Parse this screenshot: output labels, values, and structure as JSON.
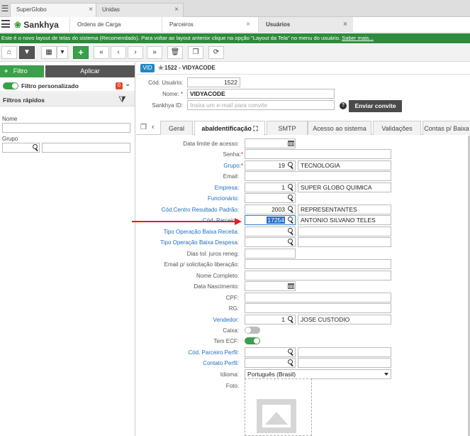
{
  "browser_tabs": [
    {
      "label": "SuperGlobo",
      "active": true
    },
    {
      "label": "Unidas",
      "active": false
    }
  ],
  "app": {
    "logo_text": "Sankhya",
    "tabs": [
      {
        "label": "Ordens de Carga"
      },
      {
        "label": "Parceiros"
      },
      {
        "label": "Usuários"
      }
    ]
  },
  "notice": {
    "text": "Este é o novo layout de telas do sistema (Recomendado). Para voltar ao layout anterior clique na opção \"Layout da Tela\" no menu do usuário.",
    "link": "Saber mais..."
  },
  "toolbar": {
    "icons": [
      "home-icon",
      "filter-icon",
      "grid-icon",
      "dropdown-icon",
      "add-icon",
      "first-icon",
      "prev-icon",
      "next-icon",
      "last-icon",
      "delete-icon",
      "copy-icon",
      "refresh-icon"
    ],
    "glyphs": [
      "⌂",
      "▼",
      "▦",
      "▾",
      "+",
      "«",
      "‹",
      "›",
      "»",
      "🗑",
      "❐",
      "⟳"
    ]
  },
  "left_panel": {
    "filter_button": "Filtro",
    "apply_button": "Aplicar",
    "custom_filter_label": "Filtro personalizado",
    "custom_filter_count": "0",
    "quick_filters_title": "Filtros rápidos",
    "fields": [
      {
        "label": "Nome"
      },
      {
        "label": "Grupo"
      }
    ]
  },
  "record": {
    "badge": "VID",
    "title": "1522 - VIDYACODE",
    "cod_usuario_label": "Cód. Usuário:",
    "cod_usuario_value": "1522",
    "nome_label": "Nome:",
    "nome_value": "VIDYACODE",
    "sankhya_id_label": "Sankhya ID:",
    "sankhya_id_placeholder": "Insira um e-mail para convite",
    "invite_button": "Enviar convite"
  },
  "form_tabs": [
    {
      "label": "Geral"
    },
    {
      "label": "abaIdentificação"
    },
    {
      "label": "SMTP"
    },
    {
      "label": "Acesso ao sistema"
    },
    {
      "label": "Validações"
    },
    {
      "label": "Contas p/ Baixa"
    }
  ],
  "form": {
    "data_limite": {
      "label": "Data limite de acesso:"
    },
    "senha": {
      "label": "Senha:"
    },
    "grupo": {
      "label": "Grupo:",
      "code": "19",
      "desc": "TECNOLOGIA"
    },
    "email": {
      "label": "Email:"
    },
    "empresa": {
      "label": "Empresa:",
      "code": "1",
      "desc": "SUPER GLOBO QUIMICA"
    },
    "funcionario": {
      "label": "Funcionário:"
    },
    "centro_resultado": {
      "label": "Cód.Centro Resultado Padrão:",
      "code": "2003",
      "desc": "REPRESENTANTES"
    },
    "cod_parceiro": {
      "label": "Cód. Parceiro:",
      "code": "17254",
      "desc": "ANTONIO  SILVANO TELES"
    },
    "tipo_op_receita": {
      "label": "Tipo Operação Baixa Receita:"
    },
    "tipo_op_despesa": {
      "label": "Tipo Operação Baixa Despesa:"
    },
    "dias_tol": {
      "label": "Dias tol. juros reneg:"
    },
    "email_solic": {
      "label": "Email p/ solicitação liberação:"
    },
    "nome_completo": {
      "label": "Nome Completo:"
    },
    "data_nasc": {
      "label": "Data Nascimento:"
    },
    "cpf": {
      "label": "CPF:"
    },
    "rg": {
      "label": "RG:"
    },
    "vendedor": {
      "label": "Vendedor:",
      "code": "1",
      "desc": "JOSE CUSTODIO"
    },
    "caixa": {
      "label": "Caixa:",
      "on": false
    },
    "tem_ecf": {
      "label": "Tem ECF:",
      "on": true
    },
    "cod_parceiro_perfil": {
      "label": "Cód. Parceiro Perfil:"
    },
    "contato_perfil": {
      "label": "Contato Perfil:"
    },
    "idioma": {
      "label": "Idioma:",
      "value": "Português (Brasil)"
    },
    "foto": {
      "label": "Foto:"
    }
  }
}
